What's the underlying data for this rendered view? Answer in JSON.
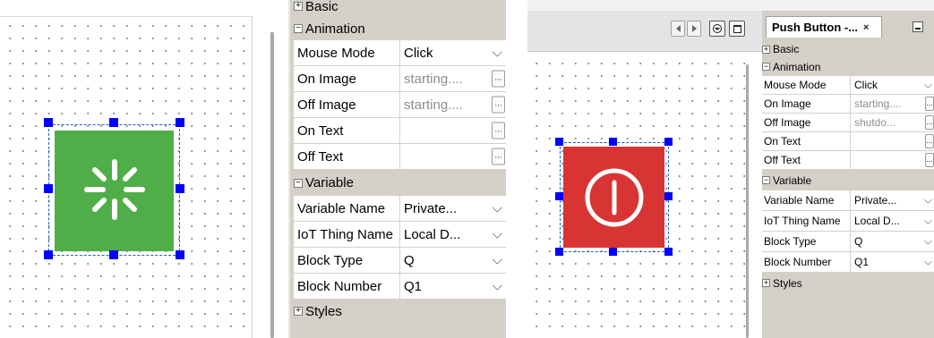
{
  "left": {
    "categories": {
      "basic": "Basic",
      "animation": "Animation",
      "variable": "Variable",
      "styles": "Styles"
    },
    "properties": {
      "mouse_mode": {
        "name": "Mouse Mode",
        "value": "Click"
      },
      "on_image": {
        "name": "On Image",
        "value": "starting...."
      },
      "off_image": {
        "name": "Off Image",
        "value": "starting...."
      },
      "on_text": {
        "name": "On Text",
        "value": ""
      },
      "off_text": {
        "name": "Off Text",
        "value": ""
      },
      "variable_name": {
        "name": "Variable Name",
        "value": "Private..."
      },
      "iot_thing_name": {
        "name": "IoT Thing Name",
        "value": "Local D..."
      },
      "block_type": {
        "name": "Block Type",
        "value": "Q"
      },
      "block_number": {
        "name": "Block Number",
        "value": "Q1"
      }
    },
    "widget_color": "#4fae47",
    "widget_icon": "loading-spinner-icon"
  },
  "right": {
    "tab_title": "Push Button -...",
    "tab_close": "×",
    "toolbar_icons": [
      "scroll-left-icon",
      "scroll-right-icon",
      "dropdown-icon",
      "maximize-icon"
    ],
    "categories": {
      "basic": "Basic",
      "animation": "Animation",
      "variable": "Variable",
      "styles": "Styles"
    },
    "properties": {
      "mouse_mode": {
        "name": "Mouse Mode",
        "value": "Click"
      },
      "on_image": {
        "name": "On Image",
        "value": "starting...."
      },
      "off_image": {
        "name": "Off Image",
        "value": "shutdo..."
      },
      "on_text": {
        "name": "On Text",
        "value": ""
      },
      "off_text": {
        "name": "Off Text",
        "value": ""
      },
      "variable_name": {
        "name": "Variable Name",
        "value": "Private..."
      },
      "iot_thing_name": {
        "name": "IoT Thing Name",
        "value": "Local D..."
      },
      "block_type": {
        "name": "Block Type",
        "value": "Q"
      },
      "block_number": {
        "name": "Block Number",
        "value": "Q1"
      }
    },
    "widget_color": "#d93434",
    "widget_icon": "power-icon"
  },
  "glyphs": {
    "expand": "+",
    "collapse": "−",
    "ellipsis": "...",
    "dropdown": "⌵"
  },
  "colors": {
    "selection_handle": "#0000ff",
    "grid_background": "#d4d0c8"
  }
}
